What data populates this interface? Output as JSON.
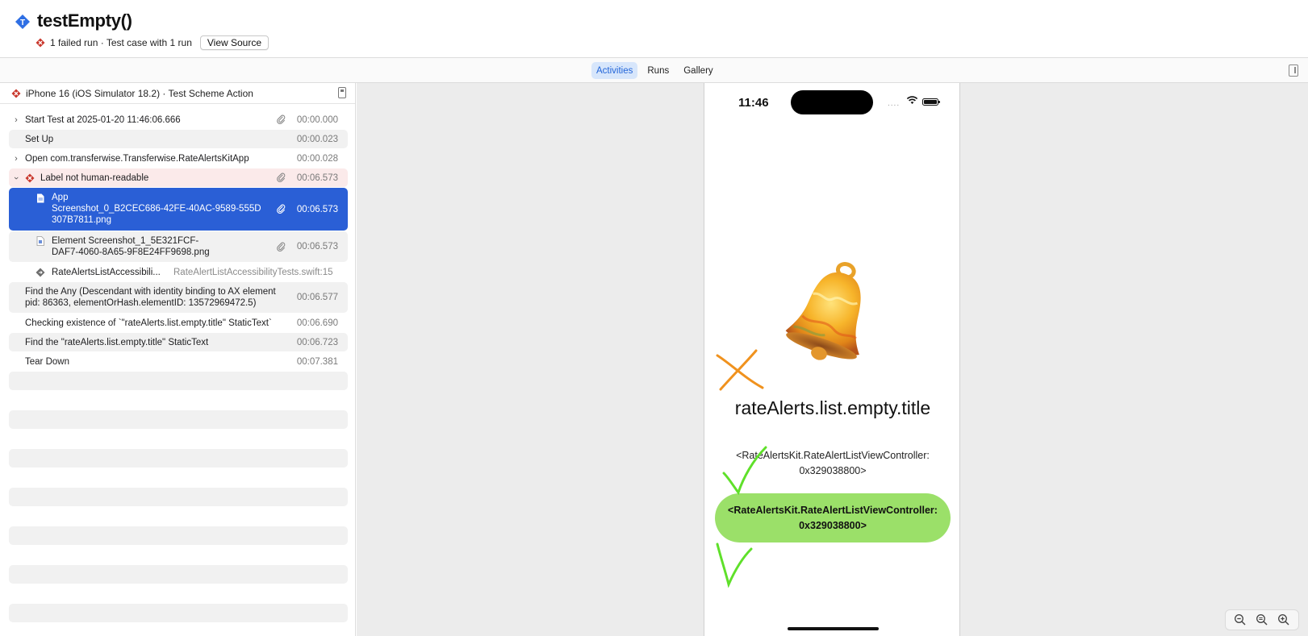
{
  "header": {
    "title": "testEmpty()",
    "subtitle_status": "1 failed run · Test case with 1 run",
    "view_source_label": "View Source"
  },
  "tabs": [
    {
      "label": "Activities",
      "active": true
    },
    {
      "label": "Runs",
      "active": false
    },
    {
      "label": "Gallery",
      "active": false
    }
  ],
  "left_panel": {
    "device_label": "iPhone 16 (iOS Simulator 18.2) · Test Scheme Action",
    "rows": [
      {
        "label": "Start Test at 2025-01-20 11:46:06.666",
        "time": "00:00.000"
      },
      {
        "label": "Set Up",
        "time": "00:00.023"
      },
      {
        "label": "Open com.transferwise.Transferwise.RateAlertsKitApp",
        "time": "00:00.028"
      },
      {
        "label": "Label not human-readable",
        "time": "00:06.573"
      },
      {
        "label_line1": "App",
        "label_line2": "Screenshot_0_B2CEC686-42FE-40AC-9589-555D",
        "label_line3": "307B7811.png",
        "time": "00:06.573"
      },
      {
        "label_line1": "Element Screenshot_1_5E321FCF-",
        "label_line2": "DAF7-4060-8A65-9F8E24FF9698.png",
        "time": "00:06.573"
      },
      {
        "label": "RateAlertsListAccessibili...",
        "file_ref": "RateAlertListAccessibilityTests.swift:15"
      },
      {
        "label_line1": "Find the Any (Descendant with identity binding to AX element",
        "label_line2": "pid: 86363, elementOrHash.elementID: 13572969472.5)",
        "time": "00:06.577"
      },
      {
        "label": "Checking existence of `\"rateAlerts.list.empty.title\" StaticText`",
        "time": "00:06.690"
      },
      {
        "label": "Find the \"rateAlerts.list.empty.title\" StaticText",
        "time": "00:06.723"
      },
      {
        "label": "Tear Down",
        "time": "00:07.381"
      }
    ]
  },
  "phone": {
    "status_time": "11:46",
    "signal_dots": "....",
    "empty_title": "rateAlerts.list.empty.title",
    "empty_subtitle": "<RateAlertsKit.RateAlertListViewController: 0x329038800>",
    "cta_label": "<RateAlertsKit.RateAlertListViewController: 0x329038800>"
  },
  "colors": {
    "accent": "#2a5fd6",
    "error": "#c9372c",
    "cta_green": "#9be069",
    "annotation_orange": "#f0921e",
    "annotation_green": "#5fe02a"
  },
  "icons": {
    "title": "test-diamond-icon",
    "failure": "failure-diamond-icon",
    "attachment": "paperclip-icon",
    "zoom_out": "zoom-out-icon",
    "zoom_fit": "zoom-fit-icon",
    "zoom_in": "zoom-in-icon"
  }
}
